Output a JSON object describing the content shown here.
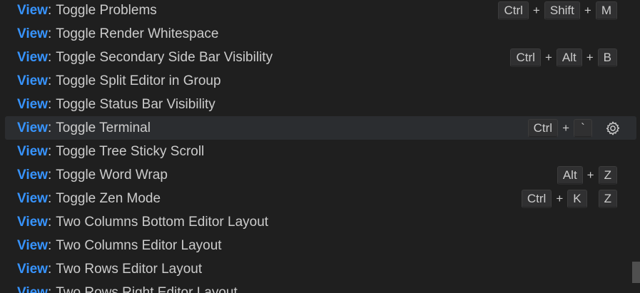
{
  "commands": [
    {
      "category": "View",
      "label": "Toggle Problems",
      "keys": [
        [
          "Ctrl",
          "Shift",
          "M"
        ]
      ]
    },
    {
      "category": "View",
      "label": "Toggle Render Whitespace",
      "keys": []
    },
    {
      "category": "View",
      "label": "Toggle Secondary Side Bar Visibility",
      "keys": [
        [
          "Ctrl",
          "Alt",
          "B"
        ]
      ]
    },
    {
      "category": "View",
      "label": "Toggle Split Editor in Group",
      "keys": []
    },
    {
      "category": "View",
      "label": "Toggle Status Bar Visibility",
      "keys": []
    },
    {
      "category": "View",
      "label": "Toggle Terminal",
      "keys": [
        [
          "Ctrl",
          "`"
        ]
      ],
      "active": true,
      "action_icon": "gear-icon"
    },
    {
      "category": "View",
      "label": "Toggle Tree Sticky Scroll",
      "keys": []
    },
    {
      "category": "View",
      "label": "Toggle Word Wrap",
      "keys": [
        [
          "Alt",
          "Z"
        ]
      ]
    },
    {
      "category": "View",
      "label": "Toggle Zen Mode",
      "keys": [
        [
          "Ctrl",
          "K"
        ],
        [
          "Z"
        ]
      ]
    },
    {
      "category": "View",
      "label": "Two Columns Bottom Editor Layout",
      "keys": []
    },
    {
      "category": "View",
      "label": "Two Columns Editor Layout",
      "keys": []
    },
    {
      "category": "View",
      "label": "Two Rows Editor Layout",
      "keys": []
    },
    {
      "category": "View",
      "label": "Two Rows Right Editor Layout",
      "keys": []
    }
  ],
  "separator": ":",
  "key_joiner": "+",
  "colors": {
    "background": "#1f1f1f",
    "category": "#3794ff",
    "text": "#cccccc",
    "active_row": "#2b2d30",
    "keycap": "#303031"
  }
}
